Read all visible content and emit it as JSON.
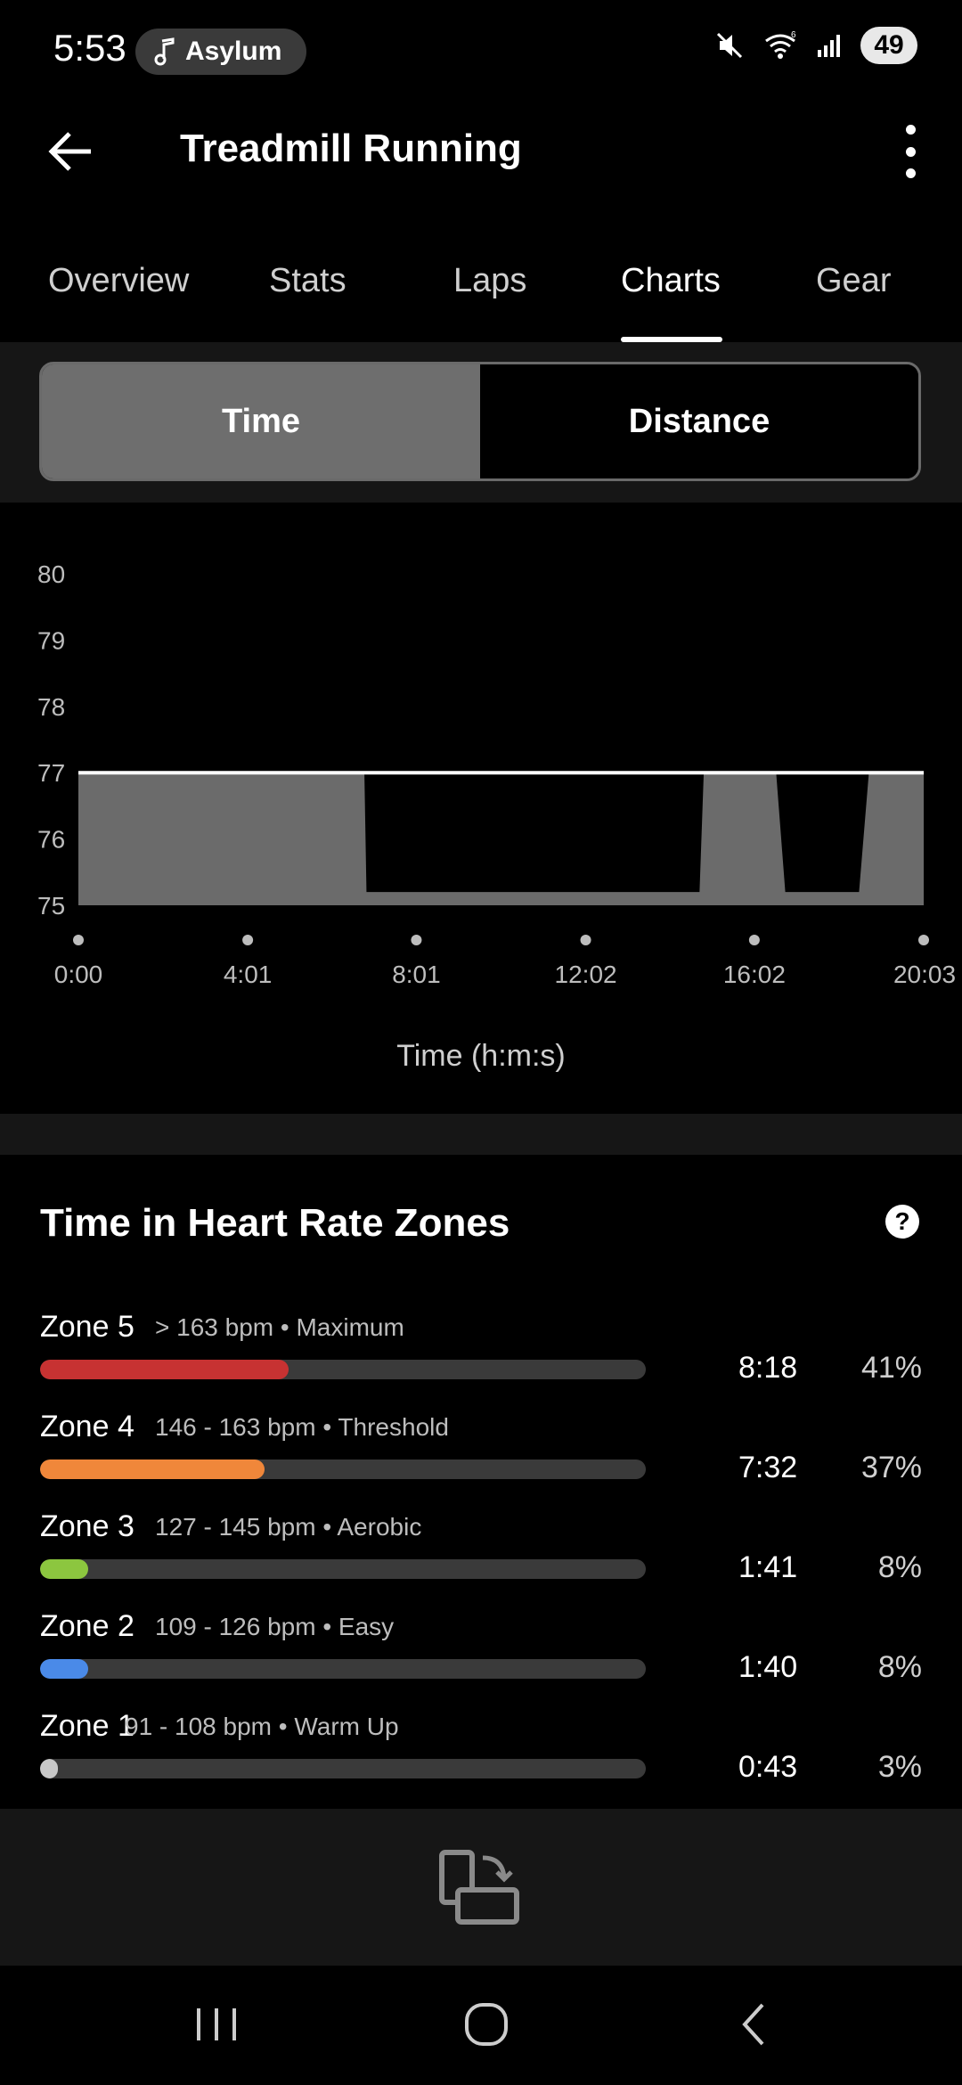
{
  "status": {
    "time": "5:53",
    "music": "Asylum",
    "battery": "49",
    "signal_label": "6"
  },
  "header": {
    "title": "Treadmill Running"
  },
  "tabs": [
    {
      "label": "Overview",
      "active": false
    },
    {
      "label": "Stats",
      "active": false
    },
    {
      "label": "Laps",
      "active": false
    },
    {
      "label": "Charts",
      "active": true
    },
    {
      "label": "Gear",
      "active": false
    }
  ],
  "segmented": {
    "options": [
      "Time",
      "Distance"
    ],
    "selected": "Time"
  },
  "chart_data": {
    "type": "area",
    "xlabel": "Time (h:m:s)",
    "ylabel": "",
    "ylim": [
      75,
      80
    ],
    "y_ticks": [
      "80",
      "79",
      "78",
      "77",
      "76",
      "75"
    ],
    "x_ticks": [
      "0:00",
      "4:01",
      "8:01",
      "12:02",
      "16:02",
      "20:03"
    ],
    "x_tick_seconds": [
      0,
      241,
      481,
      722,
      962,
      1203
    ],
    "reference_line": 77,
    "series": [
      {
        "points": [
          [
            0,
            77
          ],
          [
            407,
            77
          ],
          [
            410,
            75.2
          ],
          [
            884,
            75.2
          ],
          [
            890,
            77
          ],
          [
            993,
            77
          ],
          [
            1006,
            75.2
          ],
          [
            1111,
            75.2
          ],
          [
            1125,
            77
          ],
          [
            1203,
            77
          ]
        ]
      }
    ],
    "colors": {
      "fill": "#6b6b6b",
      "line": "#ffffff"
    }
  },
  "zones": {
    "title": "Time in Heart Rate Zones",
    "items": [
      {
        "name": "Zone 5",
        "range": "> 163 bpm • Maximum",
        "time": "8:18",
        "percent": "41%",
        "fraction": 0.41,
        "color": "#c73232"
      },
      {
        "name": "Zone 4",
        "range": "146 - 163 bpm • Threshold",
        "time": "7:32",
        "percent": "37%",
        "fraction": 0.37,
        "color": "#f0873a"
      },
      {
        "name": "Zone 3",
        "range": "127 - 145 bpm • Aerobic",
        "time": "1:41",
        "percent": "8%",
        "fraction": 0.08,
        "color": "#8cc63f"
      },
      {
        "name": "Zone 2",
        "range": "109 - 126 bpm • Easy",
        "time": "1:40",
        "percent": "8%",
        "fraction": 0.08,
        "color": "#4a8ae8"
      },
      {
        "name": "Zone 1",
        "range": "91 - 108 bpm • Warm Up",
        "time": "0:43",
        "percent": "3%",
        "fraction": 0.03,
        "color": "#c8c8c8"
      }
    ]
  },
  "icons": {
    "back": "arrow-left-icon",
    "more": "more-vertical-icon",
    "help": "question-icon",
    "rotate": "rotate-screen-icon",
    "nav_recents": "recents-icon",
    "nav_home": "home-icon",
    "nav_back": "chevron-left-icon"
  }
}
